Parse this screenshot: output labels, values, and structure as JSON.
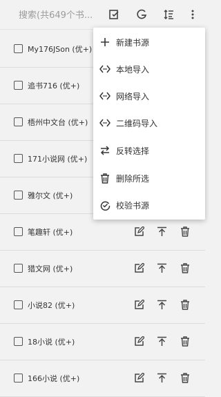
{
  "search": {
    "placeholder": "搜索(共649个书..."
  },
  "toolbar": {
    "icons": [
      "select-icon",
      "group-icon",
      "sort-icon",
      "more-vert-icon"
    ]
  },
  "rows": [
    {
      "name": "My176JSon (优+)"
    },
    {
      "name": "追书716 (优+)"
    },
    {
      "name": "梧州中文台 (优+)"
    },
    {
      "name": "171小说网 (优+)"
    },
    {
      "name": "雅尔文 (优+)"
    },
    {
      "name": "笔趣轩 (优+)"
    },
    {
      "name": "猎文网 (优+)"
    },
    {
      "name": "小说82 (优+)"
    },
    {
      "name": "18小说 (优+)"
    },
    {
      "name": "166小说 (优+)"
    }
  ],
  "menu": {
    "items": [
      {
        "label": "新建书源",
        "icon": "plus-icon"
      },
      {
        "label": "本地导入",
        "icon": "code-icon"
      },
      {
        "label": "网络导入",
        "icon": "code-icon"
      },
      {
        "label": "二维码导入",
        "icon": "code-icon"
      },
      {
        "label": "反转选择",
        "icon": "swap-icon"
      },
      {
        "label": "删除所选",
        "icon": "trash-icon"
      },
      {
        "label": "校验书源",
        "icon": "check-icon"
      }
    ]
  }
}
